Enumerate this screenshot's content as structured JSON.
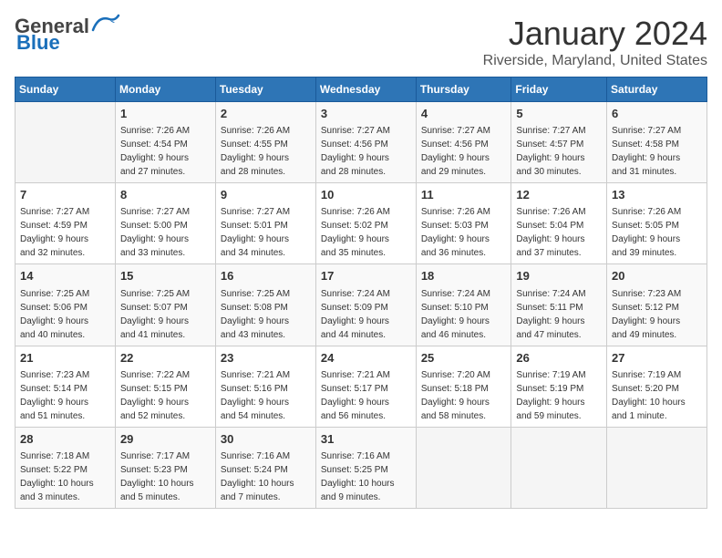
{
  "header": {
    "logo_general": "General",
    "logo_blue": "Blue",
    "month_year": "January 2024",
    "location": "Riverside, Maryland, United States"
  },
  "weekdays": [
    "Sunday",
    "Monday",
    "Tuesday",
    "Wednesday",
    "Thursday",
    "Friday",
    "Saturday"
  ],
  "weeks": [
    [
      {
        "day": "",
        "info": ""
      },
      {
        "day": "1",
        "info": "Sunrise: 7:26 AM\nSunset: 4:54 PM\nDaylight: 9 hours\nand 27 minutes."
      },
      {
        "day": "2",
        "info": "Sunrise: 7:26 AM\nSunset: 4:55 PM\nDaylight: 9 hours\nand 28 minutes."
      },
      {
        "day": "3",
        "info": "Sunrise: 7:27 AM\nSunset: 4:56 PM\nDaylight: 9 hours\nand 28 minutes."
      },
      {
        "day": "4",
        "info": "Sunrise: 7:27 AM\nSunset: 4:56 PM\nDaylight: 9 hours\nand 29 minutes."
      },
      {
        "day": "5",
        "info": "Sunrise: 7:27 AM\nSunset: 4:57 PM\nDaylight: 9 hours\nand 30 minutes."
      },
      {
        "day": "6",
        "info": "Sunrise: 7:27 AM\nSunset: 4:58 PM\nDaylight: 9 hours\nand 31 minutes."
      }
    ],
    [
      {
        "day": "7",
        "info": "Sunrise: 7:27 AM\nSunset: 4:59 PM\nDaylight: 9 hours\nand 32 minutes."
      },
      {
        "day": "8",
        "info": "Sunrise: 7:27 AM\nSunset: 5:00 PM\nDaylight: 9 hours\nand 33 minutes."
      },
      {
        "day": "9",
        "info": "Sunrise: 7:27 AM\nSunset: 5:01 PM\nDaylight: 9 hours\nand 34 minutes."
      },
      {
        "day": "10",
        "info": "Sunrise: 7:26 AM\nSunset: 5:02 PM\nDaylight: 9 hours\nand 35 minutes."
      },
      {
        "day": "11",
        "info": "Sunrise: 7:26 AM\nSunset: 5:03 PM\nDaylight: 9 hours\nand 36 minutes."
      },
      {
        "day": "12",
        "info": "Sunrise: 7:26 AM\nSunset: 5:04 PM\nDaylight: 9 hours\nand 37 minutes."
      },
      {
        "day": "13",
        "info": "Sunrise: 7:26 AM\nSunset: 5:05 PM\nDaylight: 9 hours\nand 39 minutes."
      }
    ],
    [
      {
        "day": "14",
        "info": "Sunrise: 7:25 AM\nSunset: 5:06 PM\nDaylight: 9 hours\nand 40 minutes."
      },
      {
        "day": "15",
        "info": "Sunrise: 7:25 AM\nSunset: 5:07 PM\nDaylight: 9 hours\nand 41 minutes."
      },
      {
        "day": "16",
        "info": "Sunrise: 7:25 AM\nSunset: 5:08 PM\nDaylight: 9 hours\nand 43 minutes."
      },
      {
        "day": "17",
        "info": "Sunrise: 7:24 AM\nSunset: 5:09 PM\nDaylight: 9 hours\nand 44 minutes."
      },
      {
        "day": "18",
        "info": "Sunrise: 7:24 AM\nSunset: 5:10 PM\nDaylight: 9 hours\nand 46 minutes."
      },
      {
        "day": "19",
        "info": "Sunrise: 7:24 AM\nSunset: 5:11 PM\nDaylight: 9 hours\nand 47 minutes."
      },
      {
        "day": "20",
        "info": "Sunrise: 7:23 AM\nSunset: 5:12 PM\nDaylight: 9 hours\nand 49 minutes."
      }
    ],
    [
      {
        "day": "21",
        "info": "Sunrise: 7:23 AM\nSunset: 5:14 PM\nDaylight: 9 hours\nand 51 minutes."
      },
      {
        "day": "22",
        "info": "Sunrise: 7:22 AM\nSunset: 5:15 PM\nDaylight: 9 hours\nand 52 minutes."
      },
      {
        "day": "23",
        "info": "Sunrise: 7:21 AM\nSunset: 5:16 PM\nDaylight: 9 hours\nand 54 minutes."
      },
      {
        "day": "24",
        "info": "Sunrise: 7:21 AM\nSunset: 5:17 PM\nDaylight: 9 hours\nand 56 minutes."
      },
      {
        "day": "25",
        "info": "Sunrise: 7:20 AM\nSunset: 5:18 PM\nDaylight: 9 hours\nand 58 minutes."
      },
      {
        "day": "26",
        "info": "Sunrise: 7:19 AM\nSunset: 5:19 PM\nDaylight: 9 hours\nand 59 minutes."
      },
      {
        "day": "27",
        "info": "Sunrise: 7:19 AM\nSunset: 5:20 PM\nDaylight: 10 hours\nand 1 minute."
      }
    ],
    [
      {
        "day": "28",
        "info": "Sunrise: 7:18 AM\nSunset: 5:22 PM\nDaylight: 10 hours\nand 3 minutes."
      },
      {
        "day": "29",
        "info": "Sunrise: 7:17 AM\nSunset: 5:23 PM\nDaylight: 10 hours\nand 5 minutes."
      },
      {
        "day": "30",
        "info": "Sunrise: 7:16 AM\nSunset: 5:24 PM\nDaylight: 10 hours\nand 7 minutes."
      },
      {
        "day": "31",
        "info": "Sunrise: 7:16 AM\nSunset: 5:25 PM\nDaylight: 10 hours\nand 9 minutes."
      },
      {
        "day": "",
        "info": ""
      },
      {
        "day": "",
        "info": ""
      },
      {
        "day": "",
        "info": ""
      }
    ]
  ]
}
